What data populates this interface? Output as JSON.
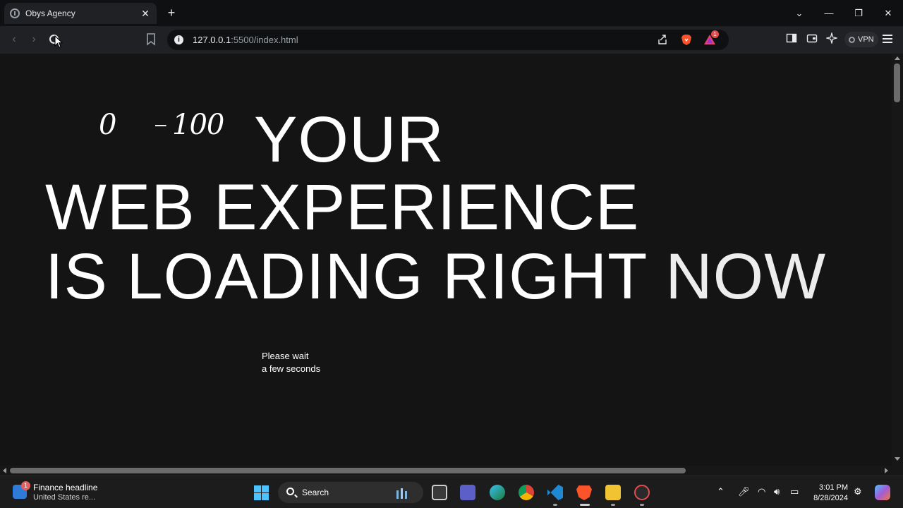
{
  "browser": {
    "tab": {
      "title": "Obys Agency",
      "close": "✕"
    },
    "new_tab": "+",
    "window_controls": {
      "dropdown": "⌄",
      "minimize": "—",
      "restore": "❐",
      "close": "✕"
    },
    "url_host": "127.0.0.1",
    "url_path": ":5500/index.html",
    "rewards_badge": "1",
    "vpn_label": "VPN"
  },
  "page": {
    "counter": "0",
    "counter_separator": "–",
    "counter_max": "100",
    "headline": {
      "line1": "YOUR",
      "line2": "WEB EXPERIENCE",
      "line3_a": "IS LOADING RIGHT",
      "line3_b": "NOW"
    },
    "wait_line1": "Please wait",
    "wait_line2": "a few seconds"
  },
  "taskbar": {
    "news_badge": "1",
    "news_title": "Finance headline",
    "news_subtitle": "United States re...",
    "search_label": "Search",
    "time": "3:01 PM",
    "date": "8/28/2024"
  },
  "colors": {
    "page_background": "#141414",
    "headline": "#ffffff",
    "accent_blue": "#4cc2ff",
    "brave_orange": "#fb542b"
  }
}
